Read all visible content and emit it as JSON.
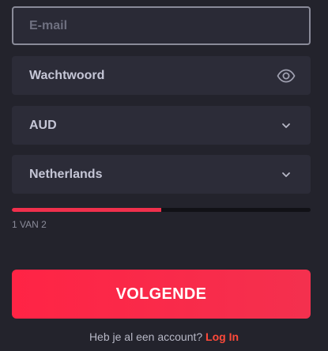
{
  "form": {
    "email": {
      "placeholder": "E-mail",
      "value": ""
    },
    "password": {
      "label": "Wachtwoord",
      "toggle_icon": "eye-icon"
    },
    "currency": {
      "value": "AUD",
      "icon": "chevron-down-icon"
    },
    "country": {
      "value": "Netherlands",
      "icon": "chevron-down-icon"
    }
  },
  "progress": {
    "fraction": 0.5,
    "step_text": "1 VAN 2",
    "fill_color": "#f0304c"
  },
  "next_button": {
    "label": "VOLGENDE",
    "color": "#ff2445"
  },
  "footer": {
    "question": "Heb je al een account?",
    "login_link": "Log In",
    "link_color": "#ff4a3a"
  }
}
